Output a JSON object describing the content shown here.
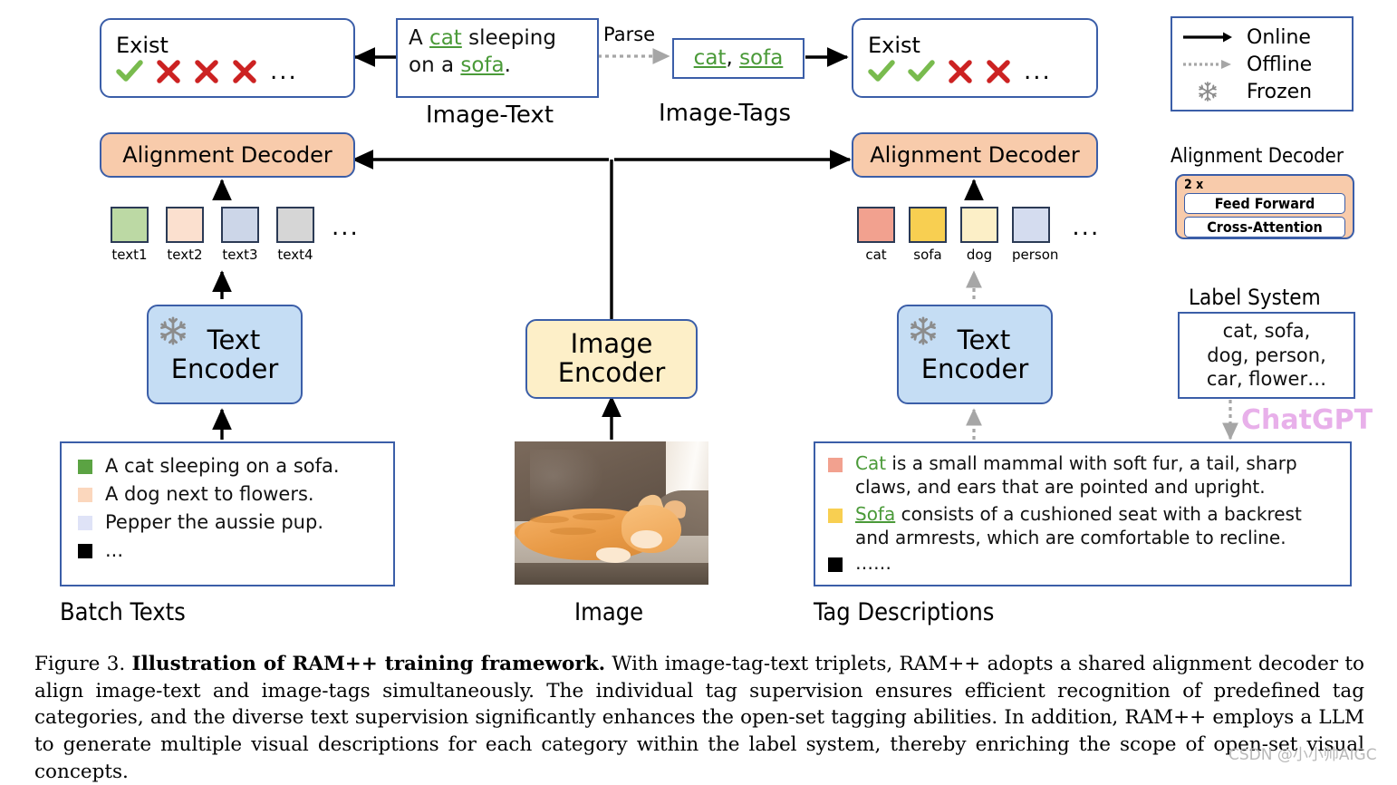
{
  "figure": {
    "number": "Figure 3.",
    "bold_title": "Illustration of RAM++ training framework.",
    "body": "With image-tag-text triplets, RAM++ adopts a shared alignment decoder to align image-text and image-tags simultaneously. The individual tag supervision ensures efficient recognition of predefined tag categories, and the diverse text supervision significantly enhances the open-set tagging abilities. In addition, RAM++ employs a LLM to generate multiple visual descriptions for each category within the label system, thereby enriching the scope of open-set visual concepts.",
    "watermark": "CSDN @小小帅AIGC"
  },
  "left_branch": {
    "exist": {
      "title": "Exist",
      "marks": [
        "check",
        "cross",
        "cross",
        "cross"
      ],
      "ellipsis": "..."
    },
    "decoder_label": "Alignment Decoder",
    "embeddings": [
      {
        "label": "text1",
        "color": "#bcd9a4"
      },
      {
        "label": "text2",
        "color": "#fbe0cf"
      },
      {
        "label": "text3",
        "color": "#ccd6e8"
      },
      {
        "label": "text4",
        "color": "#d6d6d6"
      }
    ],
    "embeddings_ellipsis": "...",
    "encoder": {
      "line1": "Text",
      "line2": "Encoder",
      "frozen_icon": "snowflake-icon"
    },
    "batch_texts": [
      {
        "swatch": "#5ba343",
        "text": "A cat sleeping on a sofa."
      },
      {
        "swatch": "#fbd7bd",
        "text": "A dog next to flowers."
      },
      {
        "swatch": "#dfe3f7",
        "text": "Pepper the aussie pup."
      },
      {
        "swatch": "#000000",
        "text": "..."
      }
    ],
    "caption": "Batch Texts"
  },
  "middle_branch": {
    "image_text": {
      "line1_pre": "A ",
      "line1_tag": "cat",
      "line1_post": " sleeping",
      "line2_pre": "on a ",
      "line2_tag": "sofa",
      "line2_post": "."
    },
    "image_text_caption": "Image-Text",
    "parse_label": "Parse",
    "image_tags": {
      "tag1": "cat",
      "separator": ", ",
      "tag2": "sofa"
    },
    "image_tags_caption": "Image-Tags",
    "encoder": {
      "line1": "Image",
      "line2": "Encoder"
    },
    "photo_alt": "orange cat sleeping on a brown sofa",
    "caption": "Image"
  },
  "right_branch": {
    "exist": {
      "title": "Exist",
      "marks": [
        "check",
        "check",
        "cross",
        "cross"
      ],
      "ellipsis": "..."
    },
    "decoder_label": "Alignment Decoder",
    "embeddings": [
      {
        "label": "cat",
        "color": "#f2a18f"
      },
      {
        "label": "sofa",
        "color": "#f8cf51"
      },
      {
        "label": "dog",
        "color": "#fcefc7"
      },
      {
        "label": "person",
        "color": "#d4dcef"
      }
    ],
    "embeddings_ellipsis": "...",
    "encoder": {
      "line1": "Text",
      "line2": "Encoder",
      "frozen_icon": "snowflake-icon"
    },
    "tag_descriptions": [
      {
        "swatch": "#f2a18f",
        "tag": "Cat",
        "tag_underline": false,
        "text": " is a small mammal with soft fur, a tail, sharp claws, and ears that are pointed and upright."
      },
      {
        "swatch": "#f8cf51",
        "tag": "Sofa",
        "tag_underline": true,
        "text": " consists of a cushioned seat with a backrest and armrests, which are comfortable to recline."
      },
      {
        "swatch": "#000000",
        "tag": "",
        "tag_underline": false,
        "text": "……"
      }
    ],
    "caption": "Tag Descriptions"
  },
  "legend": {
    "items": [
      {
        "label": "Online",
        "style": "solid-arrow",
        "color": "#000000"
      },
      {
        "label": "Offline",
        "style": "dotted-arrow",
        "color": "#a6a6a6"
      },
      {
        "label": "Frozen",
        "style": "snowflake-icon",
        "color": "#8c8c8c"
      }
    ]
  },
  "decoder_detail": {
    "title": "Alignment Decoder",
    "repeat": "2 x",
    "blocks": [
      "Feed Forward",
      "Cross-Attention"
    ]
  },
  "label_system": {
    "title": "Label System",
    "lines": [
      "cat, sofa,",
      "dog, person,",
      "car, flower…"
    ],
    "llm_label": "ChatGPT",
    "llm_color": "#e8b0ea"
  }
}
